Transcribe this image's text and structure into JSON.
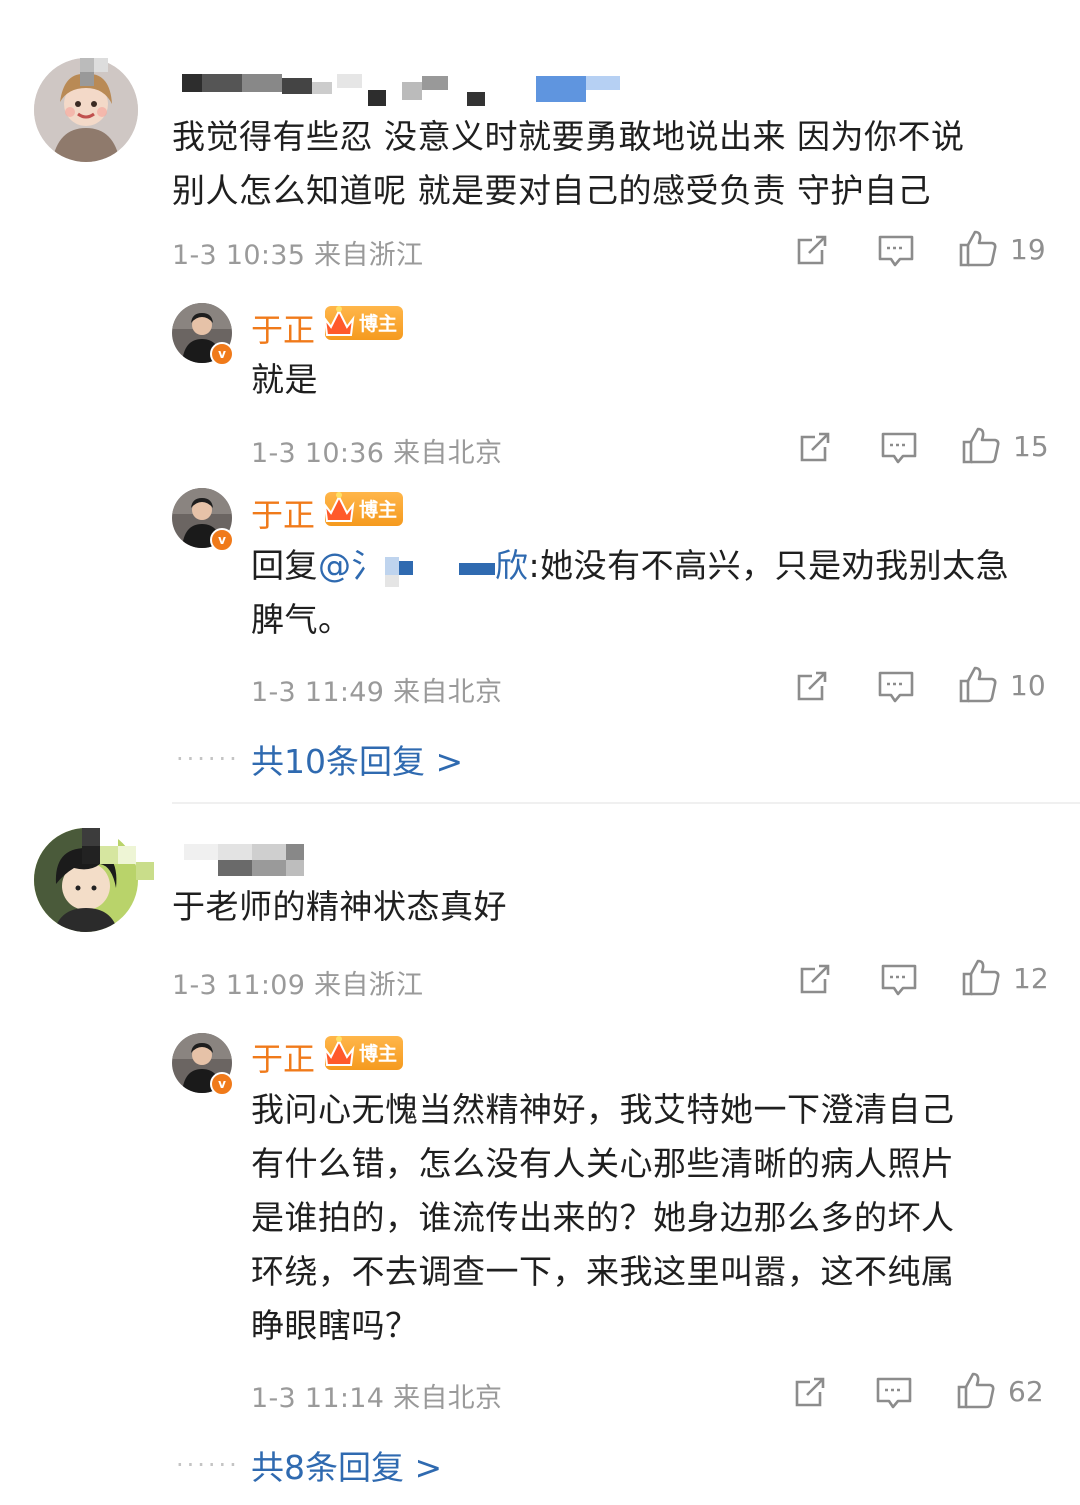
{
  "comments": [
    {
      "text_line1": "我觉得有些忍 没意义时就要勇敢地说出来 因为你不说",
      "text_line2": "别人怎么知道呢 就是要对自己的感受负责 守护自己",
      "meta": "1-3 10:35  来自浙江",
      "likes": "19",
      "replies": [
        {
          "name": "于正",
          "badge": "博主",
          "text": "就是",
          "meta": "1-3 10:36  来自北京",
          "likes": "15"
        },
        {
          "name": "于正",
          "badge": "博主",
          "reply_prefix": "回复",
          "mention_start": "@氵",
          "mention_end": "欣",
          "text_line1": ":她没有不高兴，只是劝我别太急",
          "text_line2": "脾气。",
          "meta": "1-3 11:49  来自北京",
          "likes": "10"
        }
      ],
      "more_dots": "......",
      "more_replies": "共10条回复 >"
    },
    {
      "text_line1": "于老师的精神状态真好",
      "meta": "1-3 11:09  来自浙江",
      "likes": "12",
      "replies": [
        {
          "name": "于正",
          "badge": "博主",
          "text_line1": "我问心无愧当然精神好，我艾特她一下澄清自己",
          "text_line2": "有什么错，怎么没有人关心那些清晰的病人照片",
          "text_line3": "是谁拍的，谁流传出来的？她身边那么多的坏人",
          "text_line4": "环绕，不去调查一下，来我这里叫嚣，这不纯属",
          "text_line5": "睁眼瞎吗？",
          "meta": "1-3 11:14  来自北京",
          "likes": "62"
        }
      ],
      "more_dots": "......",
      "more_replies": "共8条回复 >"
    }
  ],
  "icons": {
    "share": "share-icon",
    "comment": "comment-icon",
    "like": "thumbs-up-icon",
    "verified": "verified-v-icon",
    "crown": "crown-icon"
  },
  "badge_v": "v",
  "colors": {
    "name": "#f07a1a",
    "link": "#2f6ab0",
    "meta": "#9a9a9a",
    "badge_bg": "#f59a1e"
  }
}
